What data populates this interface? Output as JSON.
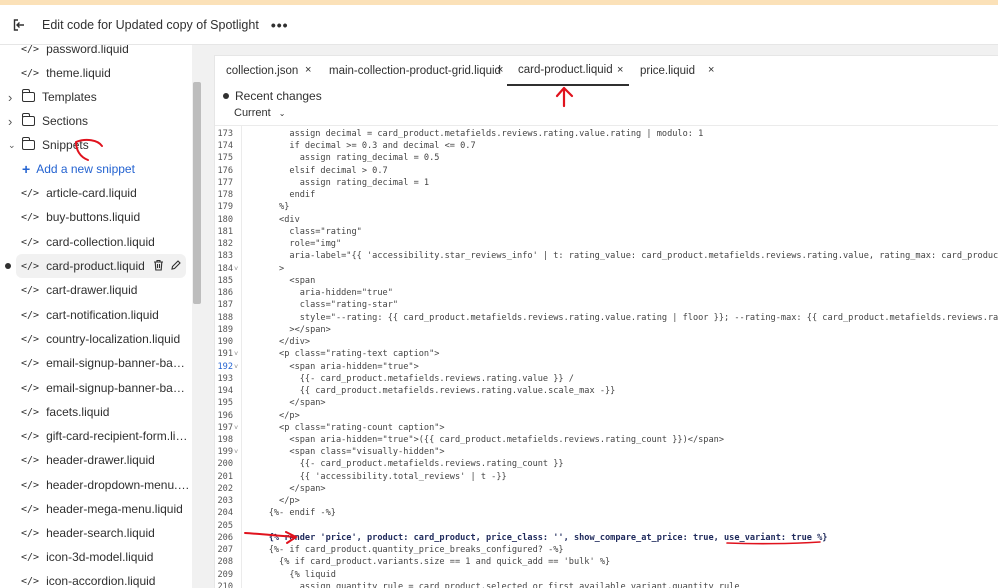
{
  "topbar": {
    "exit_icon": "exit-icon",
    "title": "Edit code for Updated copy of Spotlight",
    "more_label": "•••"
  },
  "sidebar": {
    "items": [
      {
        "label": "password.liquid",
        "type": "file"
      },
      {
        "label": "theme.liquid",
        "type": "file"
      },
      {
        "label": "Templates",
        "type": "folder-collapsed"
      },
      {
        "label": "Sections",
        "type": "folder-collapsed"
      },
      {
        "label": "Snippets",
        "type": "folder-expanded"
      },
      {
        "label": "Add a new snippet",
        "type": "add"
      },
      {
        "label": "article-card.liquid",
        "type": "file"
      },
      {
        "label": "buy-buttons.liquid",
        "type": "file"
      },
      {
        "label": "card-collection.liquid",
        "type": "file"
      },
      {
        "label": "card-product.liquid",
        "type": "file-selected"
      },
      {
        "label": "cart-drawer.liquid",
        "type": "file"
      },
      {
        "label": "cart-notification.liquid",
        "type": "file"
      },
      {
        "label": "country-localization.liquid",
        "type": "file"
      },
      {
        "label": "email-signup-banner-background...",
        "type": "file"
      },
      {
        "label": "email-signup-banner-background...",
        "type": "file"
      },
      {
        "label": "facets.liquid",
        "type": "file"
      },
      {
        "label": "gift-card-recipient-form.liquid",
        "type": "file"
      },
      {
        "label": "header-drawer.liquid",
        "type": "file"
      },
      {
        "label": "header-dropdown-menu.liquid",
        "type": "file"
      },
      {
        "label": "header-mega-menu.liquid",
        "type": "file"
      },
      {
        "label": "header-search.liquid",
        "type": "file"
      },
      {
        "label": "icon-3d-model.liquid",
        "type": "file"
      },
      {
        "label": "icon-accordion.liquid",
        "type": "file"
      }
    ],
    "file_icon": "</>"
  },
  "tabs": [
    {
      "label": "collection.json",
      "active": false
    },
    {
      "label": "main-collection-product-grid.liquid",
      "active": false
    },
    {
      "label": "card-product.liquid",
      "active": true
    },
    {
      "label": "price.liquid",
      "active": false
    }
  ],
  "editor": {
    "changes_label": "Recent changes",
    "version_label": "Current",
    "lines": [
      {
        "n": "173",
        "fold": false,
        "hl": false,
        "code": "        assign decimal = card_product.metafields.reviews.rating.value.rating | modulo: 1"
      },
      {
        "n": "174",
        "fold": false,
        "hl": false,
        "code": "        if decimal >= 0.3 and decimal <= 0.7"
      },
      {
        "n": "175",
        "fold": false,
        "hl": false,
        "code": "          assign rating_decimal = 0.5"
      },
      {
        "n": "176",
        "fold": false,
        "hl": false,
        "code": "        elsif decimal > 0.7"
      },
      {
        "n": "177",
        "fold": false,
        "hl": false,
        "code": "          assign rating_decimal = 1"
      },
      {
        "n": "178",
        "fold": false,
        "hl": false,
        "code": "        endif"
      },
      {
        "n": "179",
        "fold": false,
        "hl": false,
        "code": "      %}"
      },
      {
        "n": "180",
        "fold": false,
        "hl": false,
        "code": "      <div"
      },
      {
        "n": "181",
        "fold": false,
        "hl": false,
        "code": "        class=\"rating\""
      },
      {
        "n": "182",
        "fold": false,
        "hl": false,
        "code": "        role=\"img\""
      },
      {
        "n": "183",
        "fold": false,
        "hl": false,
        "code": "        aria-label=\"{{ 'accessibility.star_reviews_info' | t: rating_value: card_product.metafields.reviews.rating.value, rating_max: card_product.m"
      },
      {
        "n": "184",
        "fold": true,
        "hl": false,
        "code": "      >"
      },
      {
        "n": "185",
        "fold": false,
        "hl": false,
        "code": "        <span"
      },
      {
        "n": "186",
        "fold": false,
        "hl": false,
        "code": "          aria-hidden=\"true\""
      },
      {
        "n": "187",
        "fold": false,
        "hl": false,
        "code": "          class=\"rating-star\""
      },
      {
        "n": "188",
        "fold": false,
        "hl": false,
        "code": "          style=\"--rating: {{ card_product.metafields.reviews.rating.value.rating | floor }}; --rating-max: {{ card_product.metafields.reviews.ratin"
      },
      {
        "n": "189",
        "fold": false,
        "hl": false,
        "code": "        ></span>"
      },
      {
        "n": "190",
        "fold": false,
        "hl": false,
        "code": "      </div>"
      },
      {
        "n": "191",
        "fold": true,
        "hl": false,
        "code": "      <p class=\"rating-text caption\">"
      },
      {
        "n": "192",
        "fold": true,
        "hl": true,
        "code": "        <span aria-hidden=\"true\">"
      },
      {
        "n": "193",
        "fold": false,
        "hl": false,
        "code": "          {{- card_product.metafields.reviews.rating.value }} /"
      },
      {
        "n": "194",
        "fold": false,
        "hl": false,
        "code": "          {{ card_product.metafields.reviews.rating.value.scale_max -}}"
      },
      {
        "n": "195",
        "fold": false,
        "hl": false,
        "code": "        </span>"
      },
      {
        "n": "196",
        "fold": false,
        "hl": false,
        "code": "      </p>"
      },
      {
        "n": "197",
        "fold": true,
        "hl": false,
        "code": "      <p class=\"rating-count caption\">"
      },
      {
        "n": "198",
        "fold": false,
        "hl": false,
        "code": "        <span aria-hidden=\"true\">({{ card_product.metafields.reviews.rating_count }})</span>"
      },
      {
        "n": "199",
        "fold": true,
        "hl": false,
        "code": "        <span class=\"visually-hidden\">"
      },
      {
        "n": "200",
        "fold": false,
        "hl": false,
        "code": "          {{- card_product.metafields.reviews.rating_count }}"
      },
      {
        "n": "201",
        "fold": false,
        "hl": false,
        "code": "          {{ 'accessibility.total_reviews' | t -}}"
      },
      {
        "n": "202",
        "fold": false,
        "hl": false,
        "code": "        </span>"
      },
      {
        "n": "203",
        "fold": false,
        "hl": false,
        "code": "      </p>"
      },
      {
        "n": "204",
        "fold": false,
        "hl": false,
        "code": "    {%- endif -%}"
      },
      {
        "n": "205",
        "fold": false,
        "hl": false,
        "code": ""
      },
      {
        "n": "206",
        "fold": false,
        "hl": false,
        "code": "    {% render 'price', product: card_product, price_class: '', show_compare_at_price: true, use_variant: true %}"
      },
      {
        "n": "207",
        "fold": false,
        "hl": false,
        "code": "    {%- if card_product.quantity_price_breaks_configured? -%}"
      },
      {
        "n": "208",
        "fold": false,
        "hl": false,
        "code": "      {% if card_product.variants.size == 1 and quick_add == 'bulk' %}"
      },
      {
        "n": "209",
        "fold": false,
        "hl": false,
        "code": "        {% liquid"
      },
      {
        "n": "210",
        "fold": false,
        "hl": false,
        "code": "          assign quantity_rule = card_product.selected_or_first_available_variant.quantity_rule"
      }
    ]
  },
  "colors": {
    "accent": "#2463d1",
    "annotation": "#e0121d",
    "banner": "#fbe1b8"
  }
}
